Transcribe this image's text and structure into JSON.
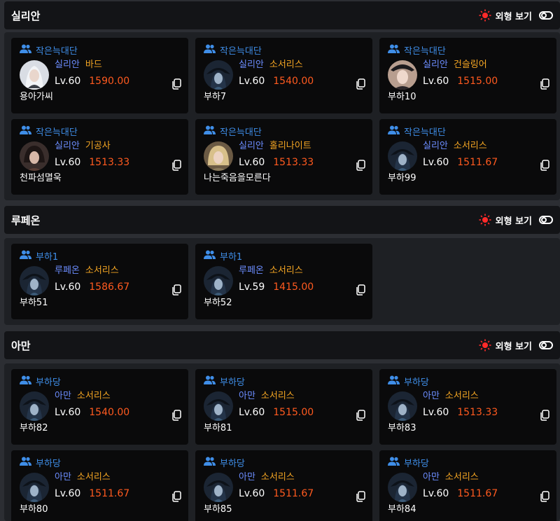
{
  "appearance_label": "외형 보기",
  "sections": [
    {
      "title": "실리안",
      "cards": [
        {
          "party": "작은늑대단",
          "server": "실리안",
          "class": "바드",
          "level": "Lv.60",
          "item_level": "1590.00",
          "name": "용아가씨",
          "avatar": "bard"
        },
        {
          "party": "작은늑대단",
          "server": "실리안",
          "class": "소서리스",
          "level": "Lv.60",
          "item_level": "1540.00",
          "name": "부하7",
          "avatar": "sorc"
        },
        {
          "party": "작은늑대단",
          "server": "실리안",
          "class": "건슬링어",
          "level": "Lv.60",
          "item_level": "1515.00",
          "name": "부하10",
          "avatar": "gunslinger"
        },
        {
          "party": "작은늑대단",
          "server": "실리안",
          "class": "기공사",
          "level": "Lv.60",
          "item_level": "1513.33",
          "name": "천파섬멸욱",
          "avatar": "soulfist"
        },
        {
          "party": "작은늑대단",
          "server": "실리안",
          "class": "홀리나이트",
          "level": "Lv.60",
          "item_level": "1513.33",
          "name": "나는죽음을모른다",
          "avatar": "paladin"
        },
        {
          "party": "작은늑대단",
          "server": "실리안",
          "class": "소서리스",
          "level": "Lv.60",
          "item_level": "1511.67",
          "name": "부하99",
          "avatar": "sorc"
        }
      ]
    },
    {
      "title": "루페온",
      "cards": [
        {
          "party": "부하1",
          "server": "루페온",
          "class": "소서리스",
          "level": "Lv.60",
          "item_level": "1586.67",
          "name": "부하51",
          "avatar": "sorc"
        },
        {
          "party": "부하1",
          "server": "루페온",
          "class": "소서리스",
          "level": "Lv.59",
          "item_level": "1415.00",
          "name": "부하52",
          "avatar": "sorc"
        }
      ]
    },
    {
      "title": "아만",
      "cards": [
        {
          "party": "부하당",
          "server": "아만",
          "class": "소서리스",
          "level": "Lv.60",
          "item_level": "1540.00",
          "name": "부하82",
          "avatar": "sorc"
        },
        {
          "party": "부하당",
          "server": "아만",
          "class": "소서리스",
          "level": "Lv.60",
          "item_level": "1515.00",
          "name": "부하81",
          "avatar": "sorc"
        },
        {
          "party": "부하당",
          "server": "아만",
          "class": "소서리스",
          "level": "Lv.60",
          "item_level": "1513.33",
          "name": "부하83",
          "avatar": "sorc"
        },
        {
          "party": "부하당",
          "server": "아만",
          "class": "소서리스",
          "level": "Lv.60",
          "item_level": "1511.67",
          "name": "부하80",
          "avatar": "sorc"
        },
        {
          "party": "부하당",
          "server": "아만",
          "class": "소서리스",
          "level": "Lv.60",
          "item_level": "1511.67",
          "name": "부하85",
          "avatar": "sorc"
        },
        {
          "party": "부하당",
          "server": "아만",
          "class": "소서리스",
          "level": "Lv.60",
          "item_level": "1511.67",
          "name": "부하84",
          "avatar": "sorc"
        }
      ]
    }
  ],
  "colors": {
    "party": "#3f8ee8",
    "server": "#6c8dff",
    "class": "#f5a623",
    "item_level": "#ff5a1f",
    "sun": "#ff2a2a"
  }
}
